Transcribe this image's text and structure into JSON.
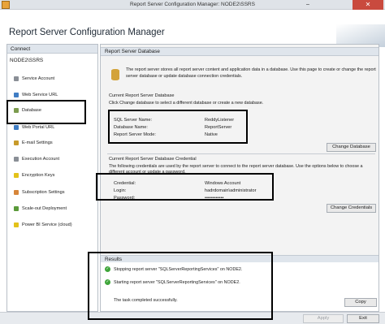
{
  "window": {
    "title": "Report Server Configuration Manager: NODE2\\SSRS",
    "close_symbol": "✕",
    "minimize_symbol": "–"
  },
  "header": {
    "heading": "Report Server Configuration Manager"
  },
  "sidebar": {
    "connect_label": "Connect",
    "server_name": "NODE2\\SSRS",
    "items": [
      {
        "label": "Service Account",
        "icon": "service-account-icon"
      },
      {
        "label": "Web Service URL",
        "icon": "web-service-icon"
      },
      {
        "label": "Database",
        "icon": "database-icon"
      },
      {
        "label": "Web Portal URL",
        "icon": "web-portal-icon"
      },
      {
        "label": "E-mail Settings",
        "icon": "email-icon"
      },
      {
        "label": "Execution Account",
        "icon": "execution-account-icon"
      },
      {
        "label": "Encryption Keys",
        "icon": "key-icon"
      },
      {
        "label": "Subscription Settings",
        "icon": "subscription-icon"
      },
      {
        "label": "Scale-out Deployment",
        "icon": "scale-out-icon"
      },
      {
        "label": "Power BI Service (cloud)",
        "icon": "power-bi-icon"
      }
    ]
  },
  "main": {
    "section_title": "Report Server Database",
    "intro": "The report server stores all report server content and application data in a database. Use this page to create or change the report server database or update database connection credentials.",
    "current_db": {
      "title": "Current Report Server Database",
      "description": "Click Change database to select a different database or create a new database.",
      "fields": [
        {
          "label": "SQL Server Name:",
          "value": "ReddyListener"
        },
        {
          "label": "Database Name:",
          "value": "ReportServer"
        },
        {
          "label": "Report Server Mode:",
          "value": "Native"
        }
      ],
      "button": "Change Database"
    },
    "credential": {
      "title": "Current Report Server Database Credential",
      "description": "The following credentials are used by the report server to connect to the report server database. Use the options below to choose a different account or update a password.",
      "fields": [
        {
          "label": "Credential:",
          "value": "Windows Account"
        },
        {
          "label": "Login:",
          "value": "hadrdomain\\administrator"
        },
        {
          "label": "Password:",
          "value": "••••••••••••"
        }
      ],
      "button": "Change Credentials"
    }
  },
  "results": {
    "title": "Results",
    "rows": [
      "Stopping report server \"SQLServerReportingServices\" on NODE2.",
      "Starting report server \"SQLServerReportingServices\" on NODE2."
    ],
    "completed": "The task completed successfully.",
    "copy_button": "Copy"
  },
  "footer": {
    "apply": "Apply",
    "exit": "Exit"
  }
}
